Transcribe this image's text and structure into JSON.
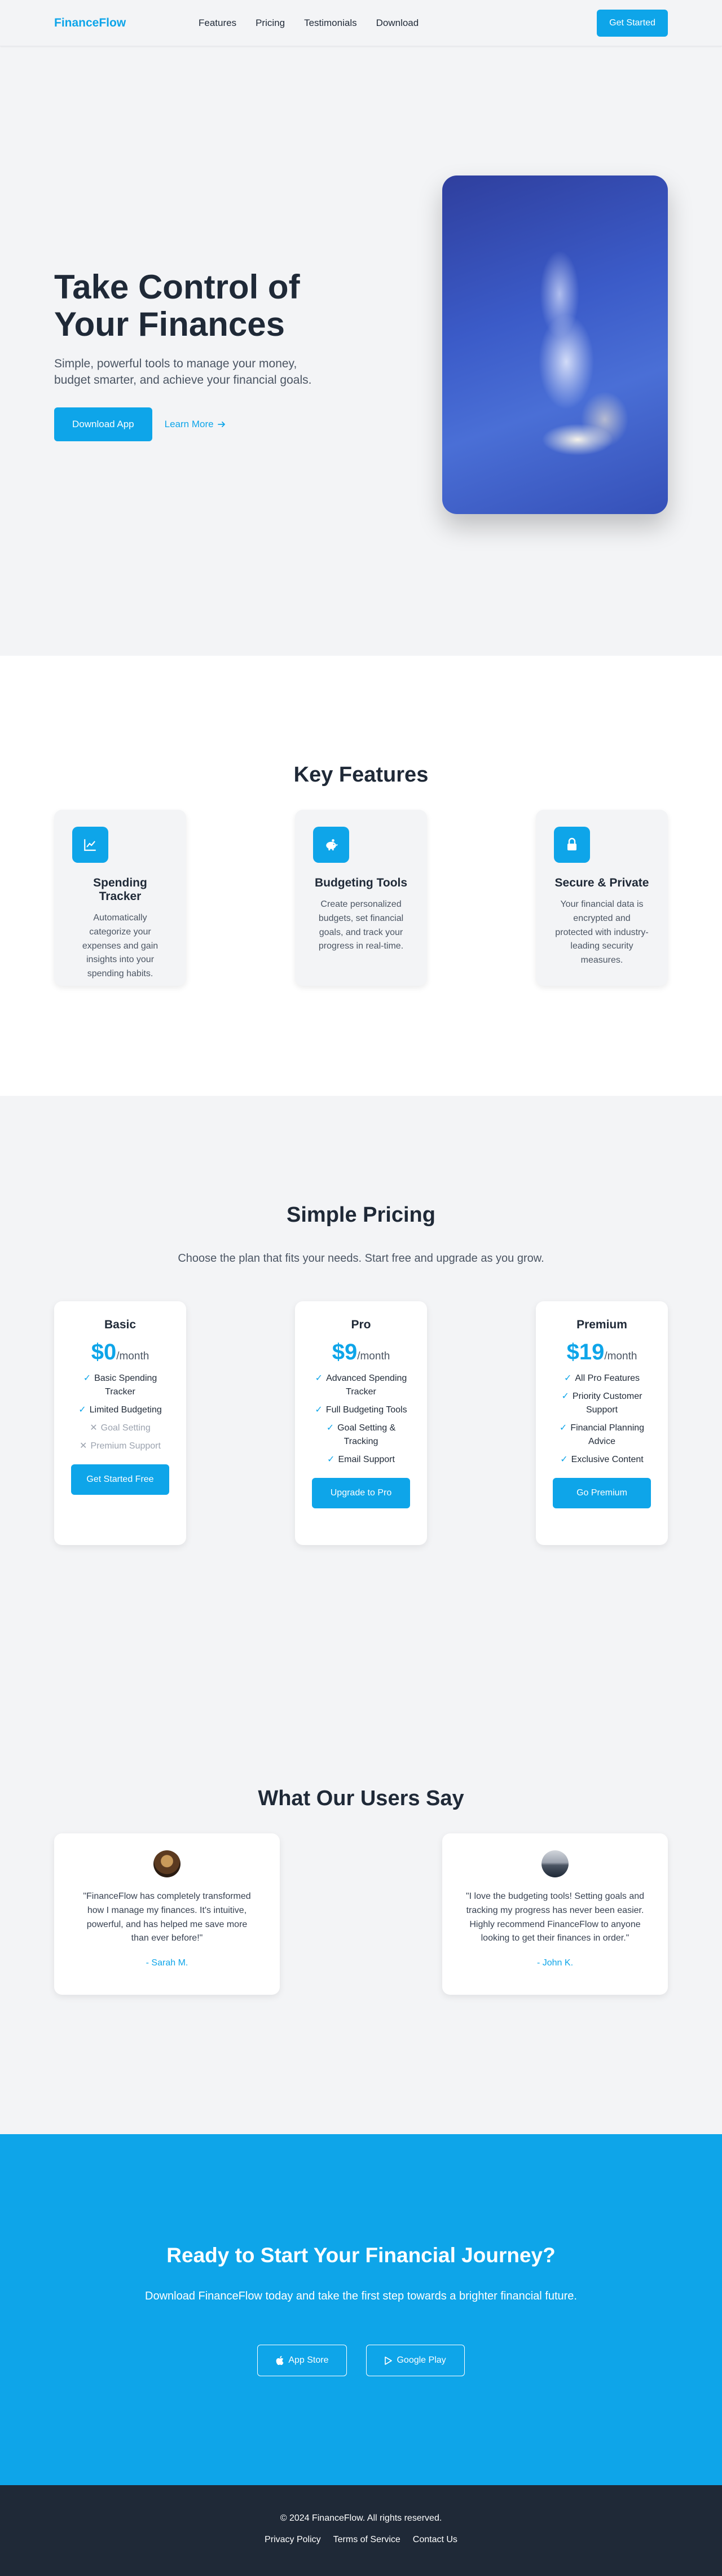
{
  "nav": {
    "logo": "FinanceFlow",
    "links": [
      "Features",
      "Pricing",
      "Testimonials",
      "Download"
    ],
    "cta": "Get Started"
  },
  "hero": {
    "title": "Take Control of Your Finances",
    "subtitle": "Simple, powerful tools to manage your money, budget smarter, and achieve your financial goals.",
    "download_label": "Download App",
    "learn_label": "Learn More"
  },
  "features": {
    "title": "Key Features",
    "items": [
      {
        "title": "Spending Tracker",
        "desc": "Automatically categorize your expenses and gain insights into your spending habits.",
        "icon": "chart-line-icon"
      },
      {
        "title": "Budgeting Tools",
        "desc": "Create personalized budgets, set financial goals, and track your progress in real-time.",
        "icon": "piggy-bank-icon"
      },
      {
        "title": "Secure & Private",
        "desc": "Your financial data is encrypted and protected with industry-leading security measures.",
        "icon": "lock-icon"
      }
    ]
  },
  "pricing": {
    "title": "Simple Pricing",
    "subtitle": "Choose the plan that fits your needs. Start free and upgrade as you grow.",
    "per": "/month",
    "plans": [
      {
        "name": "Basic",
        "price": "$0",
        "features": [
          "Basic Spending Tracker",
          "Limited Budgeting"
        ],
        "disabled": [
          "Goal Setting",
          "Premium Support"
        ],
        "button": "Get Started Free"
      },
      {
        "name": "Pro",
        "price": "$9",
        "features": [
          "Advanced Spending Tracker",
          "Full Budgeting Tools",
          "Goal Setting & Tracking",
          "Email Support"
        ],
        "disabled": [],
        "button": "Upgrade to Pro"
      },
      {
        "name": "Premium",
        "price": "$19",
        "features": [
          "All Pro Features",
          "Priority Customer Support",
          "Financial Planning Advice",
          "Exclusive Content"
        ],
        "disabled": [],
        "button": "Go Premium"
      }
    ]
  },
  "testimonials": {
    "title": "What Our Users Say",
    "items": [
      {
        "quote": "\"FinanceFlow has completely transformed how I manage my finances. It's intuitive, powerful, and has helped me save more than ever before!\"",
        "author": "- Sarah M."
      },
      {
        "quote": "\"I love the budgeting tools! Setting goals and tracking my progress has never been easier. Highly recommend FinanceFlow to anyone looking to get their finances in order.\"",
        "author": "- John K."
      }
    ]
  },
  "cta": {
    "title": "Ready to Start Your Financial Journey?",
    "subtitle": "Download FinanceFlow today and take the first step towards a brighter financial future.",
    "app_store": "App Store",
    "google_play": "Google Play"
  },
  "footer": {
    "copyright": "© 2024 FinanceFlow. All rights reserved.",
    "links": [
      "Privacy Policy",
      "Terms of Service",
      "Contact Us"
    ]
  },
  "colors": {
    "accent": "#0ea5e9",
    "dark": "#1f2937",
    "background": "#f3f4f6"
  }
}
